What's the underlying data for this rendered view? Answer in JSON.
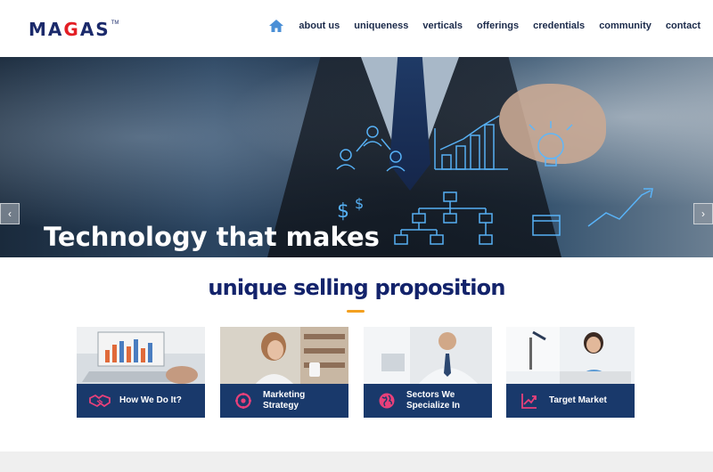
{
  "logo": {
    "text_pre": "MA",
    "text_red": "G",
    "text_post": "AS",
    "tm": "TM"
  },
  "nav": {
    "items": [
      {
        "label": "about us"
      },
      {
        "label": "uniqueness"
      },
      {
        "label": "verticals"
      },
      {
        "label": "offerings"
      },
      {
        "label": "credentials"
      },
      {
        "label": "community"
      },
      {
        "label": "contact"
      }
    ],
    "home_icon": "home-icon"
  },
  "hero": {
    "title": "Technology that makes\n life easy",
    "prev_symbol": "‹",
    "next_symbol": "›"
  },
  "usp": {
    "title": "unique selling proposition",
    "cards": [
      {
        "label": "How We Do It?",
        "icon": "handshake-icon"
      },
      {
        "label": "Marketing\nStrategy",
        "icon": "strategy-icon"
      },
      {
        "label": "Sectors We\nSpecialize In",
        "icon": "globe-icon"
      },
      {
        "label": "Target Market",
        "icon": "growth-chart-icon"
      }
    ]
  },
  "colors": {
    "brand_navy": "#13236b",
    "brand_red": "#e31e24",
    "card_bar": "#19396b",
    "accent_orange": "#f3a020",
    "icon_pink": "#e8407a"
  }
}
